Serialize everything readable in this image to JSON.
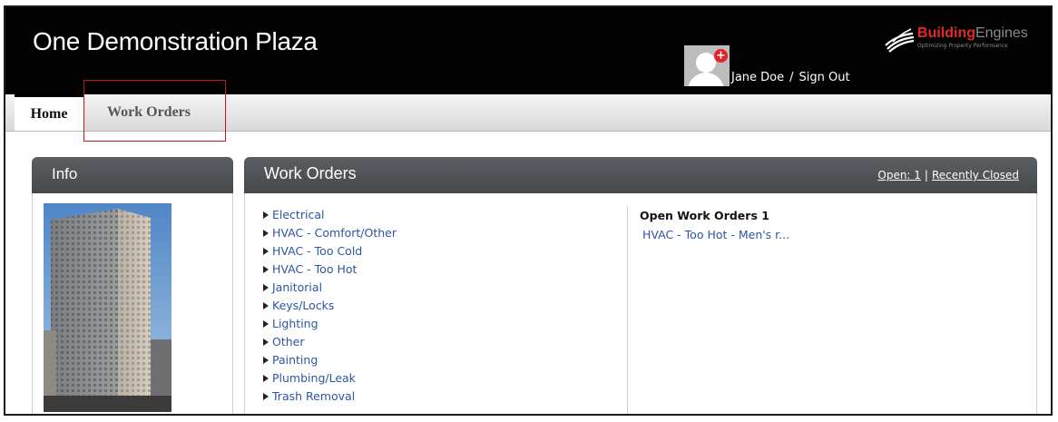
{
  "header": {
    "site_title": "One Demonstration Plaza",
    "user_name": "Jane Doe",
    "separator": "/",
    "sign_out": "Sign Out",
    "avatar_badge": "+",
    "logo": {
      "brand_bold": "Building",
      "brand_light": "Engines",
      "tagline": "Optimizing Property Performance"
    }
  },
  "nav": {
    "tabs": [
      {
        "label": "Home",
        "active": true
      },
      {
        "label": "Work Orders",
        "active": false
      }
    ]
  },
  "info_panel": {
    "title": "Info"
  },
  "work_orders_panel": {
    "title": "Work Orders",
    "open_link": "Open: 1",
    "link_separator": "|",
    "recently_closed_link": "Recently Closed",
    "categories": [
      "Electrical",
      "HVAC - Comfort/Other",
      "HVAC - Too Cold",
      "HVAC - Too Hot",
      "Janitorial",
      "Keys/Locks",
      "Lighting",
      "Other",
      "Painting",
      "Plumbing/Leak",
      "Trash Removal"
    ],
    "open_title": "Open Work Orders 1",
    "open_items": [
      "HVAC - Too Hot - Men's r..."
    ]
  },
  "colors": {
    "header_bg": "#020202",
    "link": "#2c55a3",
    "brand_red": "#e32b26",
    "highlight_red": "#c8161d",
    "panel_head": "#4f5356"
  }
}
